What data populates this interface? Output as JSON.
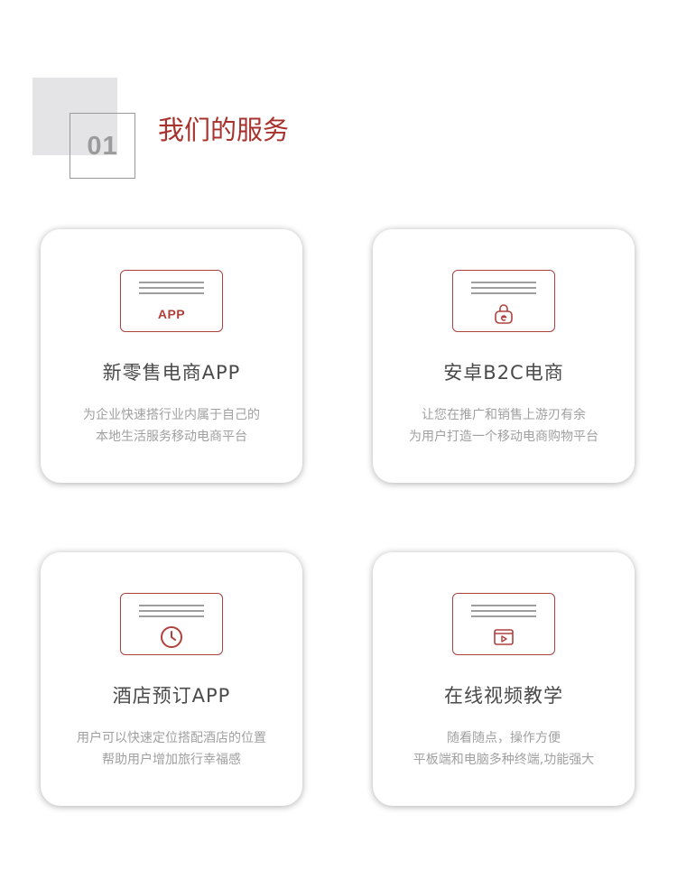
{
  "header": {
    "number": "01",
    "title": "我们的服务"
  },
  "services": [
    {
      "title": "新零售电商APP",
      "icon": "app-screen-icon",
      "icon_text": "APP",
      "desc_lines": [
        "为企业快速搭行业内属于自己的",
        "本地生活服务移动电商平台"
      ]
    },
    {
      "title": "安卓B2C电商",
      "icon": "shopping-bag-screen-icon",
      "desc_lines": [
        "让您在推广和销售上游刃有余",
        "为用户打造一个移动电商购物平台"
      ]
    },
    {
      "title": "酒店预订APP",
      "icon": "clock-screen-icon",
      "desc_lines": [
        "用户可以快速定位搭配酒店的位置",
        "帮助用户增加旅行幸福感"
      ]
    },
    {
      "title": "在线视频教学",
      "icon": "video-screen-icon",
      "desc_lines": [
        "随看随点，操作方便",
        "平板端和电脑多种终端,功能强大"
      ]
    }
  ],
  "colors": {
    "accent": "#a8322e",
    "icon_stroke": "#b0403c",
    "title_text": "#4a4a4a",
    "desc_text": "#a0a0a0",
    "header_block": "#e4e4e6"
  }
}
